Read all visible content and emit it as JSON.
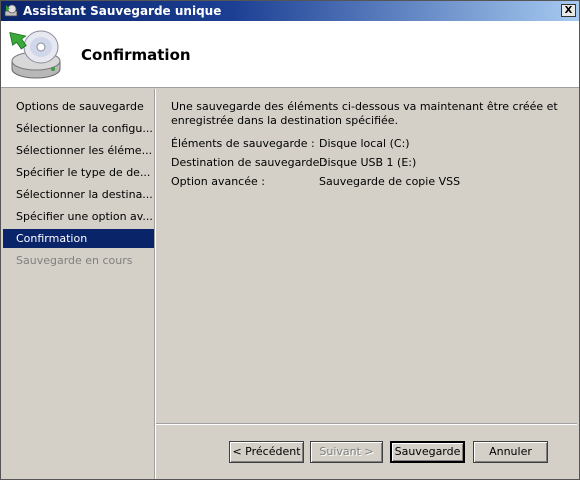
{
  "window": {
    "title": "Assistant Sauvegarde unique",
    "close_label": "X"
  },
  "header": {
    "title": "Confirmation"
  },
  "sidebar": {
    "items": [
      {
        "label": "Options de sauvegarde",
        "state": "normal"
      },
      {
        "label": "Sélectionner la configu...",
        "state": "normal"
      },
      {
        "label": "Sélectionner les éléme...",
        "state": "normal"
      },
      {
        "label": "Spécifier le type de de...",
        "state": "normal"
      },
      {
        "label": "Sélectionner la destina...",
        "state": "normal"
      },
      {
        "label": "Spécifier une option av...",
        "state": "normal"
      },
      {
        "label": "Confirmation",
        "state": "selected"
      },
      {
        "label": "Sauvegarde en cours",
        "state": "disabled"
      }
    ]
  },
  "main": {
    "intro": "Une sauvegarde des éléments ci-dessous va maintenant être créée et enregistrée dans la destination spécifiée.",
    "rows": [
      {
        "label": "Éléments de sauvegarde :",
        "value": "Disque local (C:)"
      },
      {
        "label": "Destination de sauvegarde :",
        "value": "Disque USB 1 (E:)"
      },
      {
        "label": "Option avancée :",
        "value": "Sauvegarde de copie VSS"
      }
    ]
  },
  "buttons": {
    "previous": "< Précédent",
    "next": "Suivant >",
    "backup": "Sauvegarde",
    "cancel": "Annuler"
  },
  "colors": {
    "selection": "#0a246a",
    "title_bar": "#0a246a",
    "dialog_bg": "#d4d0c8"
  },
  "icons": {
    "title": "backup-wizard-icon",
    "header": "disk-backup-icon"
  }
}
